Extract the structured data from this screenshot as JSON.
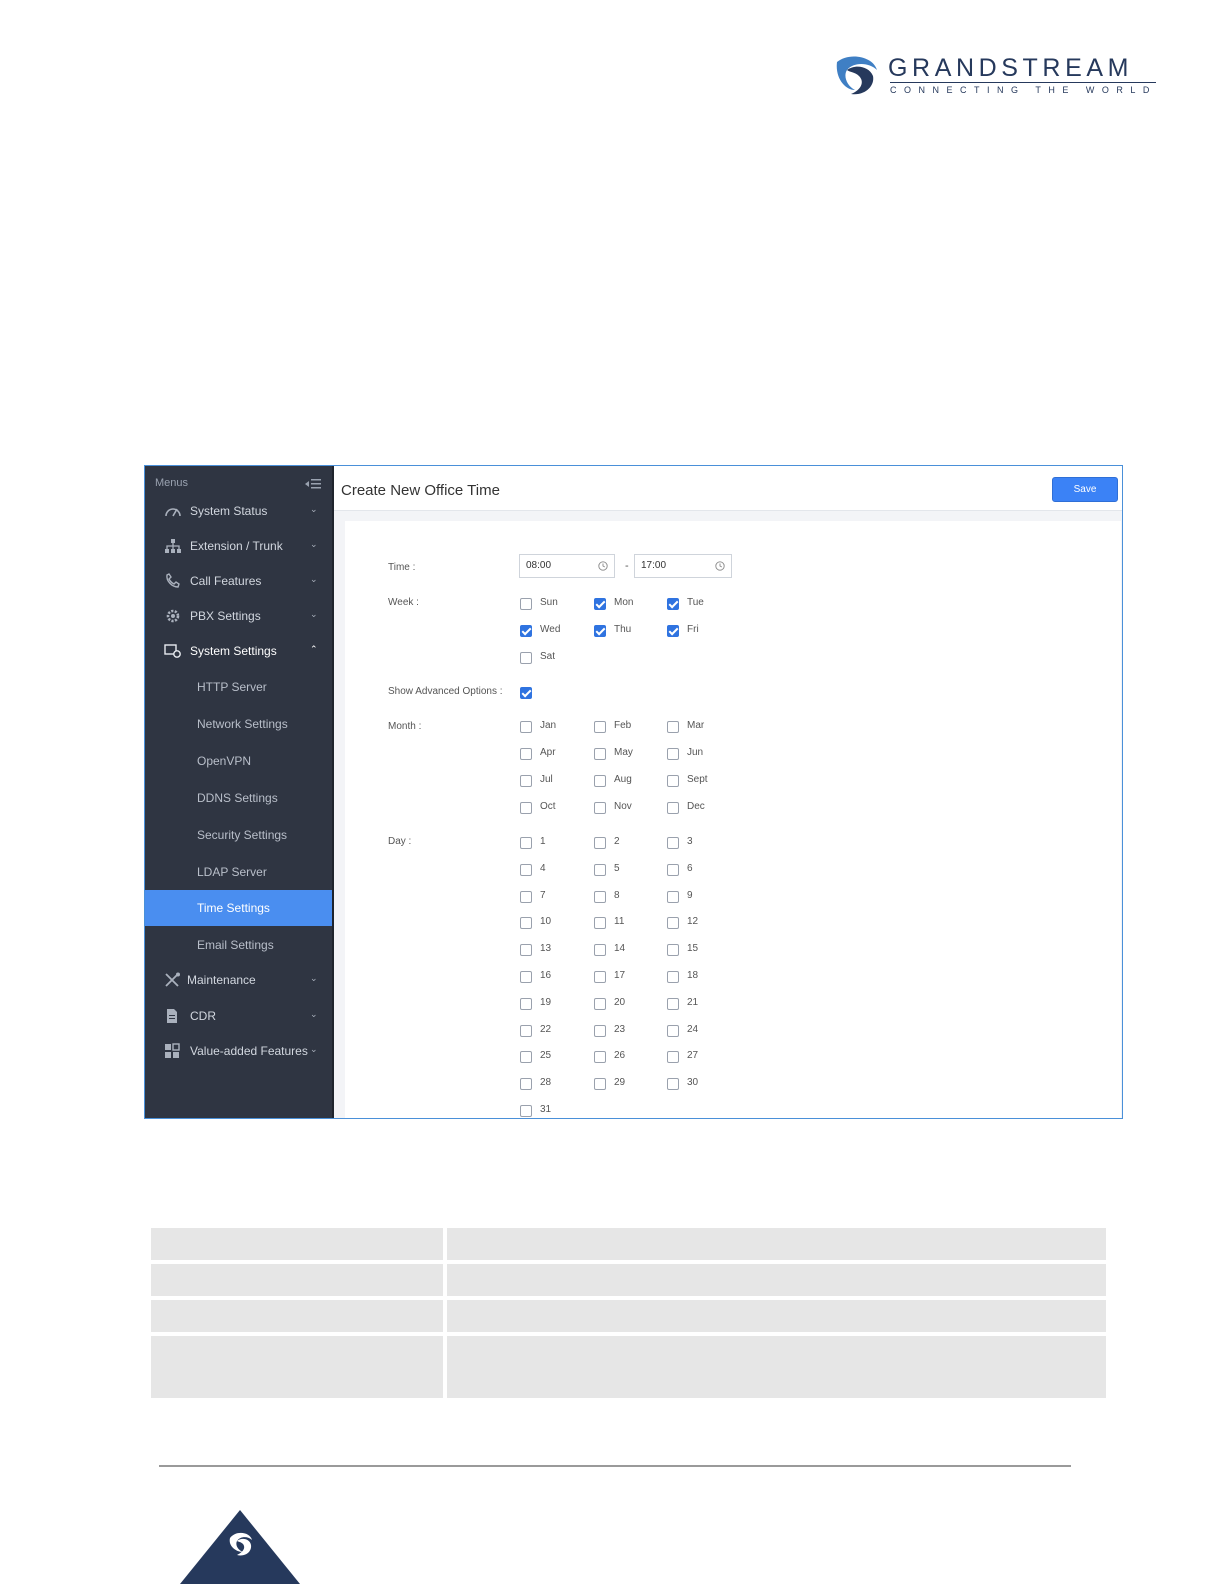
{
  "brand": {
    "name": "GRANDSTREAM",
    "tagline": "CONNECTING THE WORLD",
    "colors": {
      "navy": "#26395c",
      "blue": "#3f7fc4"
    }
  },
  "sidebar": {
    "header": "Menus",
    "items": [
      {
        "label": "System Status",
        "icon": "speedometer-icon",
        "expanded": false
      },
      {
        "label": "Extension / Trunk",
        "icon": "network-tree-icon",
        "expanded": false
      },
      {
        "label": "Call Features",
        "icon": "phone-icon",
        "expanded": false
      },
      {
        "label": "PBX Settings",
        "icon": "gear-icon",
        "expanded": false
      },
      {
        "label": "System Settings",
        "icon": "monitor-gear-icon",
        "expanded": true
      },
      {
        "label": "Maintenance",
        "icon": "tools-icon",
        "expanded": false
      },
      {
        "label": "CDR",
        "icon": "document-icon",
        "expanded": false
      },
      {
        "label": "Value-added Features",
        "icon": "grid-icon",
        "expanded": false
      }
    ],
    "sub_items": [
      {
        "label": "HTTP Server"
      },
      {
        "label": "Network Settings"
      },
      {
        "label": "OpenVPN"
      },
      {
        "label": "DDNS Settings"
      },
      {
        "label": "Security Settings"
      },
      {
        "label": "LDAP Server"
      },
      {
        "label": "Time Settings",
        "active": true
      },
      {
        "label": "Email Settings"
      }
    ],
    "colors": {
      "bg": "#2f3542",
      "active": "#4a8ef0"
    }
  },
  "main": {
    "title": "Create New Office Time",
    "save_label": "Save",
    "form": {
      "time_label": "Time :",
      "time_start": "08:00",
      "time_separator": "-",
      "time_end": "17:00",
      "week_label": "Week :",
      "week": [
        {
          "label": "Sun",
          "checked": false
        },
        {
          "label": "Mon",
          "checked": true
        },
        {
          "label": "Tue",
          "checked": true
        },
        {
          "label": "Wed",
          "checked": true
        },
        {
          "label": "Thu",
          "checked": true
        },
        {
          "label": "Fri",
          "checked": true
        },
        {
          "label": "Sat",
          "checked": false
        }
      ],
      "advanced_label": "Show Advanced Options :",
      "advanced_checked": true,
      "month_label": "Month :",
      "months": [
        {
          "label": "Jan",
          "checked": false
        },
        {
          "label": "Feb",
          "checked": false
        },
        {
          "label": "Mar",
          "checked": false
        },
        {
          "label": "Apr",
          "checked": false
        },
        {
          "label": "May",
          "checked": false
        },
        {
          "label": "Jun",
          "checked": false
        },
        {
          "label": "Jul",
          "checked": false
        },
        {
          "label": "Aug",
          "checked": false
        },
        {
          "label": "Sept",
          "checked": false
        },
        {
          "label": "Oct",
          "checked": false
        },
        {
          "label": "Nov",
          "checked": false
        },
        {
          "label": "Dec",
          "checked": false
        }
      ],
      "day_label": "Day :",
      "days": [
        "1",
        "2",
        "3",
        "4",
        "5",
        "6",
        "7",
        "8",
        "9",
        "10",
        "11",
        "12",
        "13",
        "14",
        "15",
        "16",
        "17",
        "18",
        "19",
        "20",
        "21",
        "22",
        "23",
        "24",
        "25",
        "26",
        "27",
        "28",
        "29",
        "30",
        "31"
      ]
    },
    "colors": {
      "accent": "#3b82f6",
      "checkbox_checked": "#2f73e0"
    }
  }
}
